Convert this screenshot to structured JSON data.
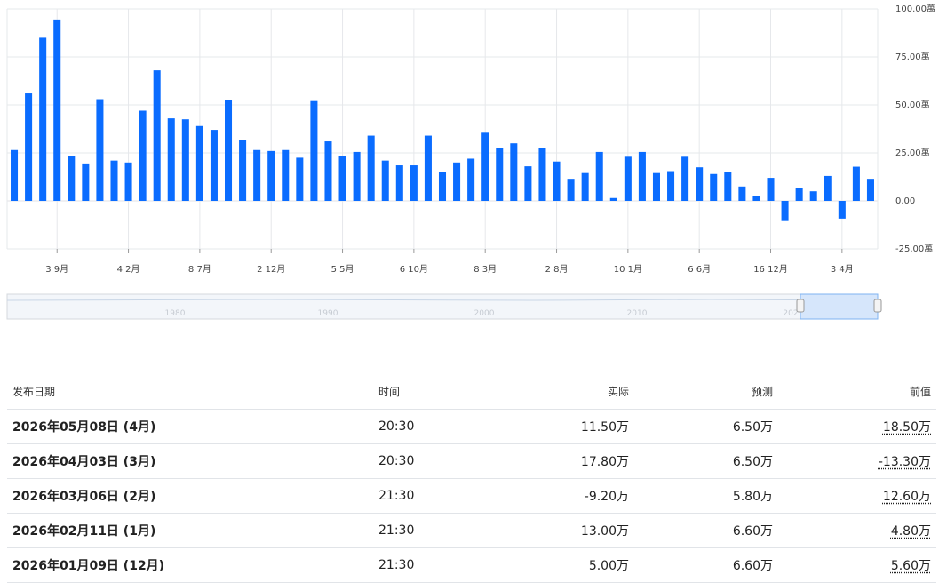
{
  "colors": {
    "bar": "#0a6cff",
    "positive": "#0a8a3a",
    "negative": "#e03024",
    "grid": "#e6e8eb",
    "navigator": "#7fb3f0"
  },
  "chart_data": {
    "type": "bar",
    "unit": "萬",
    "ylim": [
      -25,
      100
    ],
    "y_ticks": [
      100,
      75,
      50,
      25,
      0,
      -25
    ],
    "y_tick_labels": [
      "100.00萬",
      "75.00萬",
      "50.00萬",
      "25.00萬",
      "0.00",
      "-25.00萬"
    ],
    "x_tick_labels": [
      "3 9月",
      "4 2月",
      "8 7月",
      "2 12月",
      "5 5月",
      "6 10月",
      "8 3月",
      "2 8月",
      "10 1月",
      "6 6月",
      "16 12月",
      "3 4月"
    ],
    "values": [
      26.5,
      56,
      85,
      94.5,
      23.5,
      19.5,
      53,
      21,
      20,
      47,
      68,
      43,
      42.5,
      39,
      37,
      52.5,
      31.5,
      26.5,
      26,
      26.5,
      22.5,
      52,
      31,
      23.5,
      25.5,
      34,
      21,
      18.5,
      18.5,
      34,
      15,
      20,
      22,
      35.5,
      27.5,
      30,
      18,
      27.5,
      20.5,
      11.5,
      14.5,
      25.5,
      1.5,
      23,
      25.5,
      14.5,
      15.5,
      23,
      17.5,
      14,
      15,
      7.5,
      2.5,
      12,
      -10.5,
      6.5,
      5,
      13,
      -9.2,
      17.8,
      11.5
    ],
    "grid": true,
    "legend": "none"
  },
  "navigator": {
    "labels": [
      "1980",
      "1990",
      "2000",
      "2010",
      "202"
    ]
  },
  "table": {
    "headers": {
      "date": "发布日期",
      "time": "时间",
      "actual": "实际",
      "forecast": "预测",
      "previous": "前值"
    },
    "rows": [
      {
        "date": "2026年05月08日 (4月)",
        "time": "20:30",
        "actual": "11.50万",
        "actual_tone": "pos",
        "forecast": "6.50万",
        "previous": "18.50万",
        "previous_tone": "pos"
      },
      {
        "date": "2026年04月03日 (3月)",
        "time": "20:30",
        "actual": "17.80万",
        "actual_tone": "pos",
        "forecast": "6.50万",
        "previous": "-13.30万",
        "previous_tone": "neg"
      },
      {
        "date": "2026年03月06日 (2月)",
        "time": "21:30",
        "actual": "-9.20万",
        "actual_tone": "neg",
        "forecast": "5.80万",
        "previous": "12.60万",
        "previous_tone": "neg"
      },
      {
        "date": "2026年02月11日 (1月)",
        "time": "21:30",
        "actual": "13.00万",
        "actual_tone": "pos",
        "forecast": "6.60万",
        "previous": "4.80万",
        "previous_tone": "neg"
      },
      {
        "date": "2026年01月09日 (12月)",
        "time": "21:30",
        "actual": "5.00万",
        "actual_tone": "neg",
        "forecast": "6.60万",
        "previous": "5.60万",
        "previous_tone": "neg"
      }
    ]
  }
}
